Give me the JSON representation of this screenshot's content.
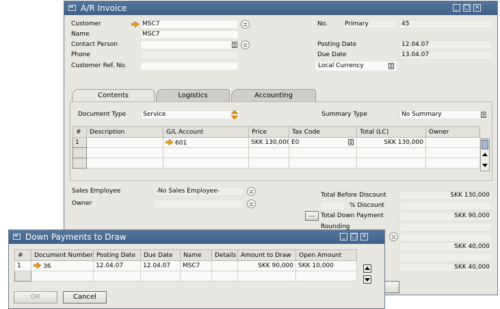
{
  "invoice": {
    "title": "A/R Invoice",
    "labels": {
      "customer": "Customer",
      "name": "Name",
      "contact_person": "Contact Person",
      "phone": "Phone",
      "customer_ref": "Customer Ref. No.",
      "no": "No.",
      "posting_date": "Posting Date",
      "due_date": "Due Date"
    },
    "values": {
      "customer": "MSC7",
      "name": "MSC7",
      "contact_person": "",
      "phone": "",
      "customer_ref": "",
      "series": "Primary",
      "number": "45",
      "posting_date": "12.04.07",
      "due_date": "13.04.07",
      "currency": "Local Currency"
    },
    "tabs": [
      "Contents",
      "Logistics",
      "Accounting"
    ],
    "doc_type_label": "Document Type",
    "doc_type_value": "Service",
    "summary_type_label": "Summary Type",
    "summary_type_value": "No Summary",
    "grid": {
      "headers": [
        "#",
        "Description",
        "G/L Account",
        "Price",
        "Tax Code",
        "Total (LC)",
        "Owner"
      ],
      "rows": [
        {
          "num": "1",
          "description": "",
          "gl_account": "601",
          "price": "SKK 130,000",
          "tax_code": "E0",
          "total": "SKK 130,000",
          "owner": ""
        }
      ]
    },
    "sales_employee_label": "Sales Employee",
    "sales_employee_value": "-No Sales Employee-",
    "owner_label": "Owner",
    "owner_value": "",
    "totals": {
      "before_discount_label": "Total Before Discount",
      "before_discount_value": "SKK 130,000",
      "discount_label": "% Discount",
      "discount_pct": "",
      "discount_value": "",
      "down_payment_label": "Total Down Payment",
      "down_payment_value": "SKK 90,000",
      "rounding_label": "Rounding",
      "rounding_value": "",
      "val_1": "",
      "val_2": "SKK 40,000",
      "val_3": "",
      "val_4": "SKK 40,000"
    },
    "dots_label": "..."
  },
  "dialog": {
    "title": "Down Payments to Draw",
    "headers": [
      "#",
      "Document Number",
      "Posting Date",
      "Due Date",
      "Name",
      "Details",
      "Amount to Draw",
      "Open Amount"
    ],
    "rows": [
      {
        "num": "1",
        "doc_number": "36",
        "posting_date": "12.04.07",
        "due_date": "12.04.07",
        "name": "MSC7",
        "details": "",
        "amount_to_draw": "SKK 90,000",
        "open_amount": "SKK 10,000"
      }
    ],
    "ok_label": "OK",
    "cancel_label": "Cancel"
  },
  "colors": {
    "titlebar": "#4a6b92",
    "window": "#e8e7e2",
    "link_arrow": "#f0a020"
  }
}
